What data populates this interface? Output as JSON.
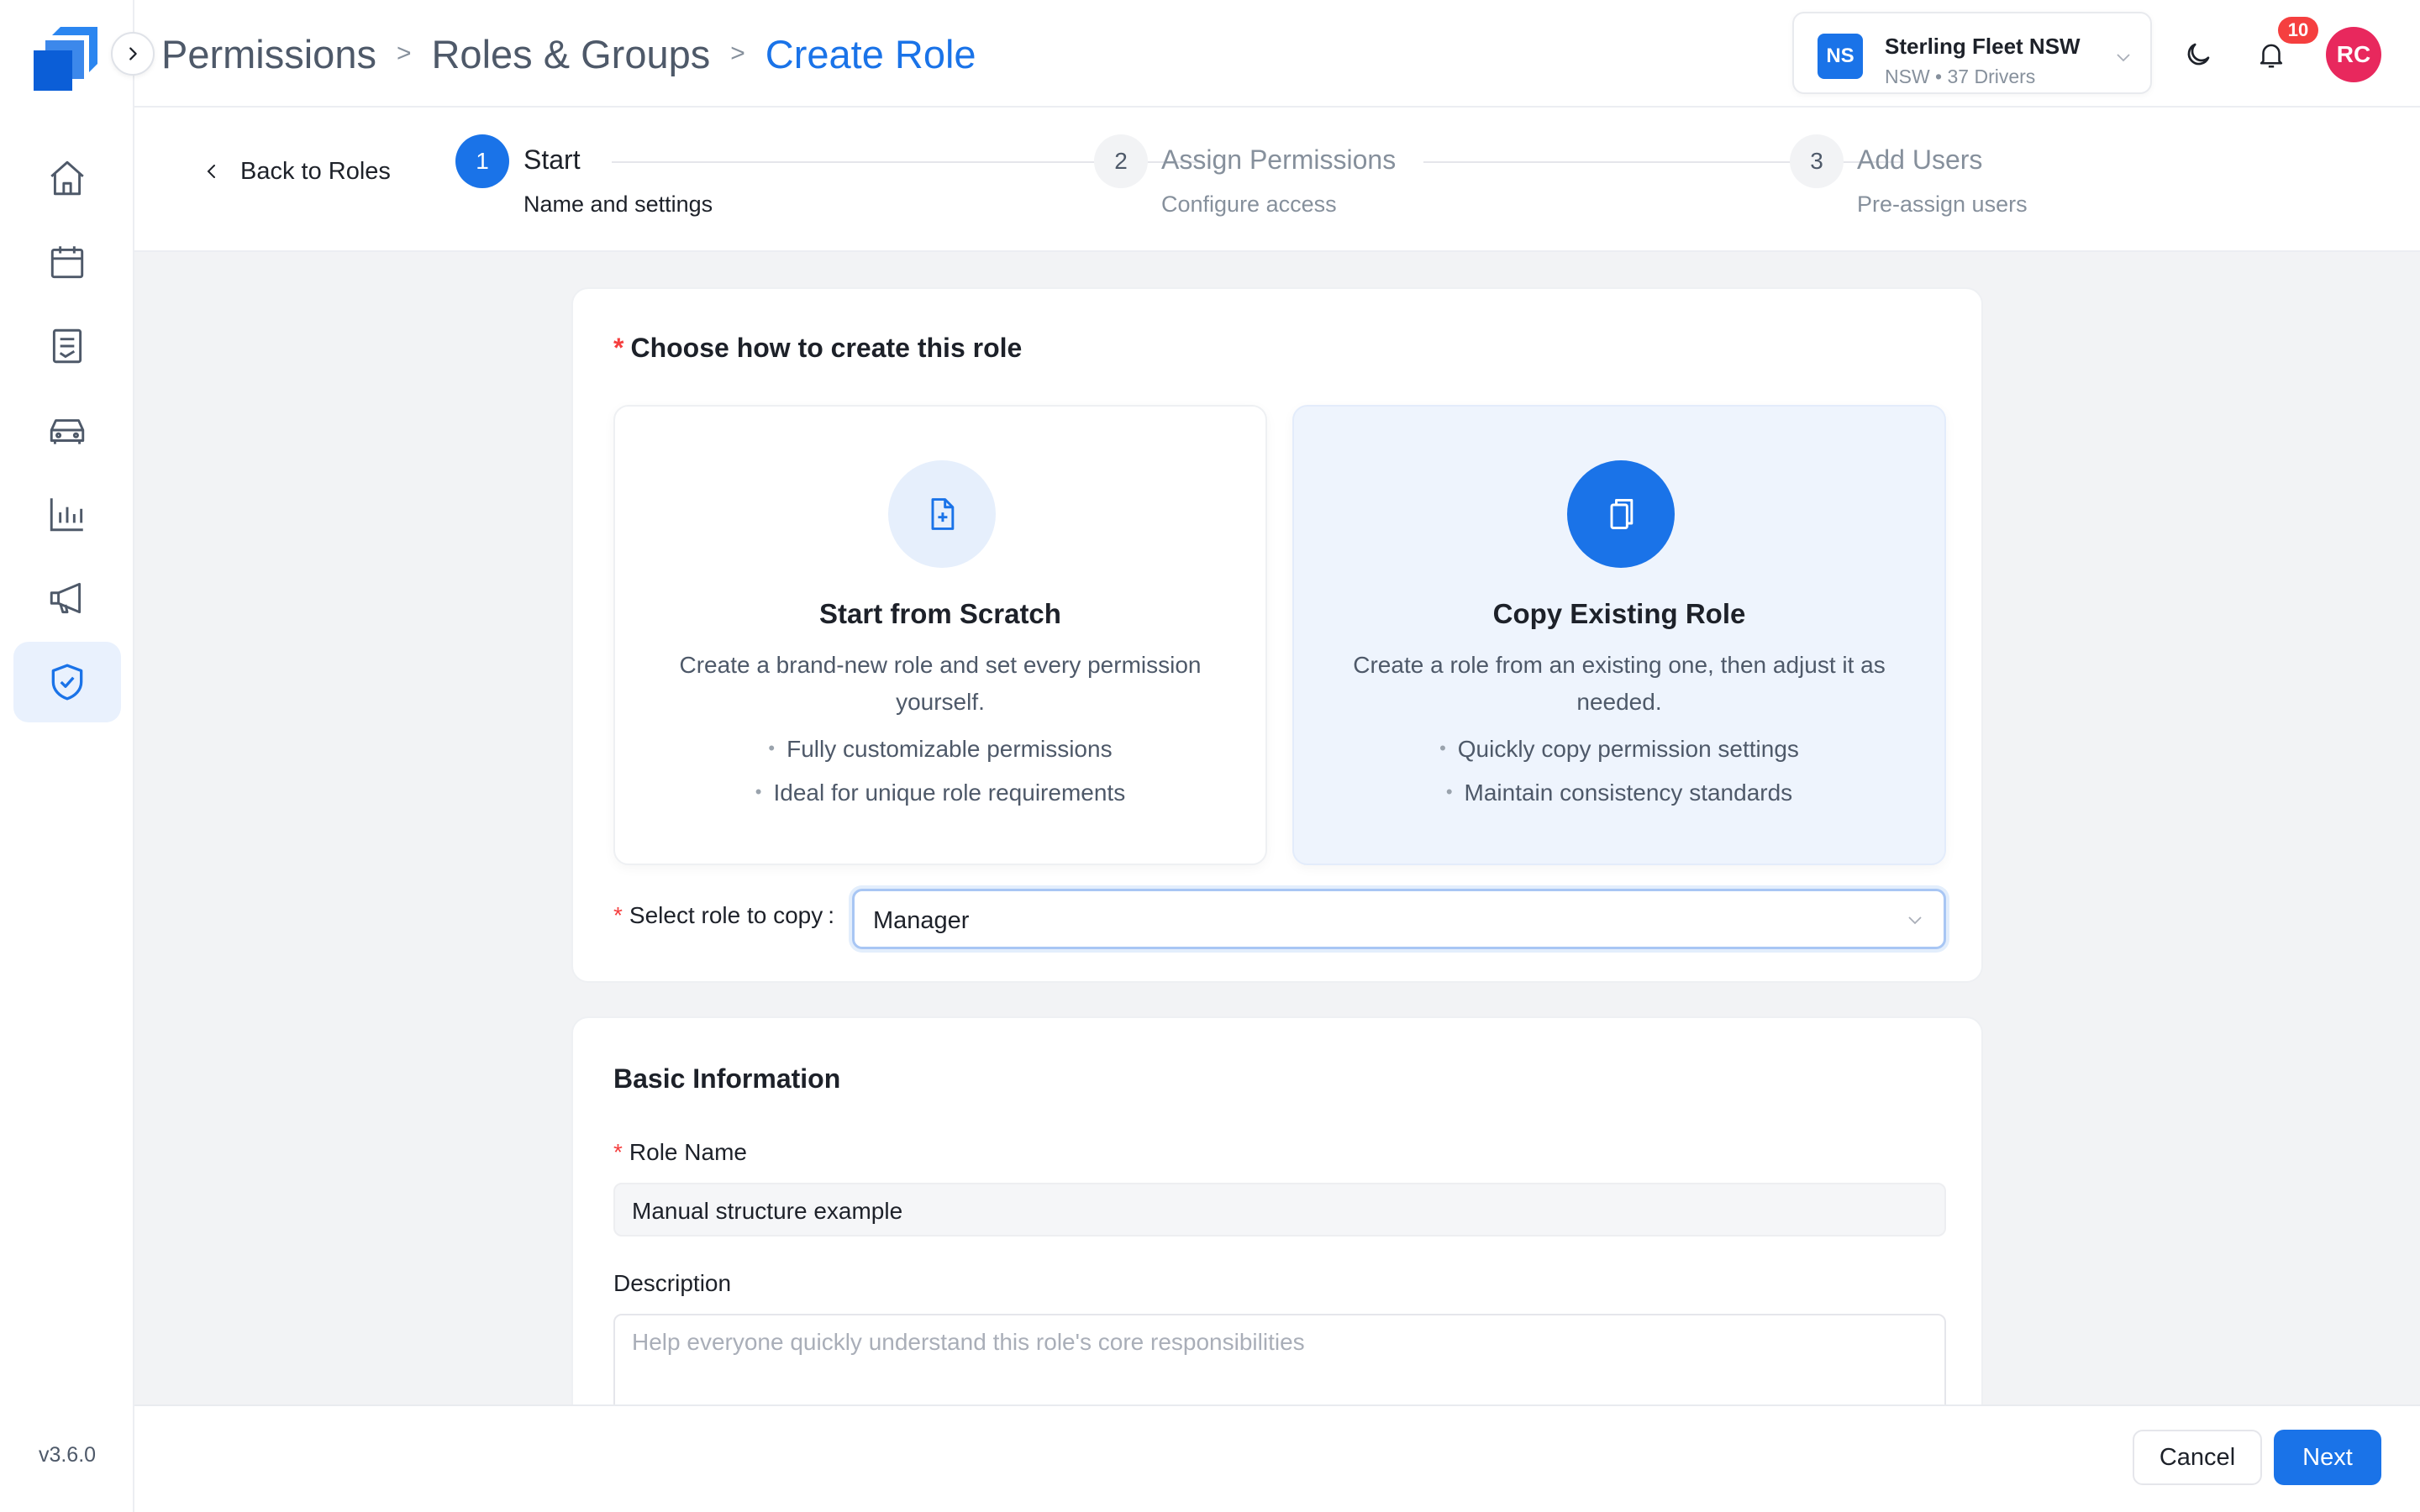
{
  "app": {
    "version": "v3.6.0"
  },
  "sidebar": {
    "items": [
      {
        "name": "home",
        "icon": "home-icon"
      },
      {
        "name": "calendar",
        "icon": "calendar-icon"
      },
      {
        "name": "documents",
        "icon": "document-list-icon"
      },
      {
        "name": "vehicles",
        "icon": "car-icon"
      },
      {
        "name": "reports",
        "icon": "bar-chart-icon"
      },
      {
        "name": "announcements",
        "icon": "megaphone-icon"
      },
      {
        "name": "permissions",
        "icon": "shield-check-icon",
        "active": true
      }
    ]
  },
  "breadcrumb": {
    "items": [
      "Permissions",
      "Roles & Groups"
    ],
    "separator": ">",
    "current": "Create Role"
  },
  "org": {
    "badge": "NS",
    "name": "Sterling Fleet NSW",
    "sub": "NSW • 37 Drivers"
  },
  "notifications": {
    "count": "10"
  },
  "user": {
    "initials": "RC"
  },
  "steps": {
    "back_label": "Back to Roles",
    "items": [
      {
        "num": "1",
        "title": "Start",
        "sub": "Name and settings",
        "state": "active"
      },
      {
        "num": "2",
        "title": "Assign Permissions",
        "sub": "Configure access",
        "state": "pending"
      },
      {
        "num": "3",
        "title": "Add Users",
        "sub": "Pre-assign users",
        "state": "pending"
      }
    ]
  },
  "create_method": {
    "required_mark": "*",
    "title": "Choose how to create this role",
    "options": [
      {
        "icon": "new-document-icon",
        "title": "Start from Scratch",
        "desc": "Create a brand-new role and set every permission yourself.",
        "bullets": [
          "Fully customizable permissions",
          "Ideal for unique role requirements"
        ],
        "selected": false
      },
      {
        "icon": "copy-document-icon",
        "title": "Copy Existing Role",
        "desc": "Create a role from an existing one, then adjust it as needed.",
        "bullets": [
          "Quickly copy permission settings",
          "Maintain consistency standards"
        ],
        "selected": true
      }
    ],
    "select_label": "Select role to copy",
    "select_colon": ":",
    "select_value": "Manager"
  },
  "basic_info": {
    "title": "Basic Information",
    "role_name_label": "Role Name",
    "role_name_value": "Manual structure example",
    "description_label": "Description",
    "description_placeholder": "Help everyone quickly understand this role's core responsibilities"
  },
  "footer": {
    "cancel_label": "Cancel",
    "next_label": "Next"
  },
  "colors": {
    "accent": "#1a73e8",
    "danger": "#f53f3f",
    "avatar": "#e8285d",
    "selected_bg": "#eef4fd"
  }
}
